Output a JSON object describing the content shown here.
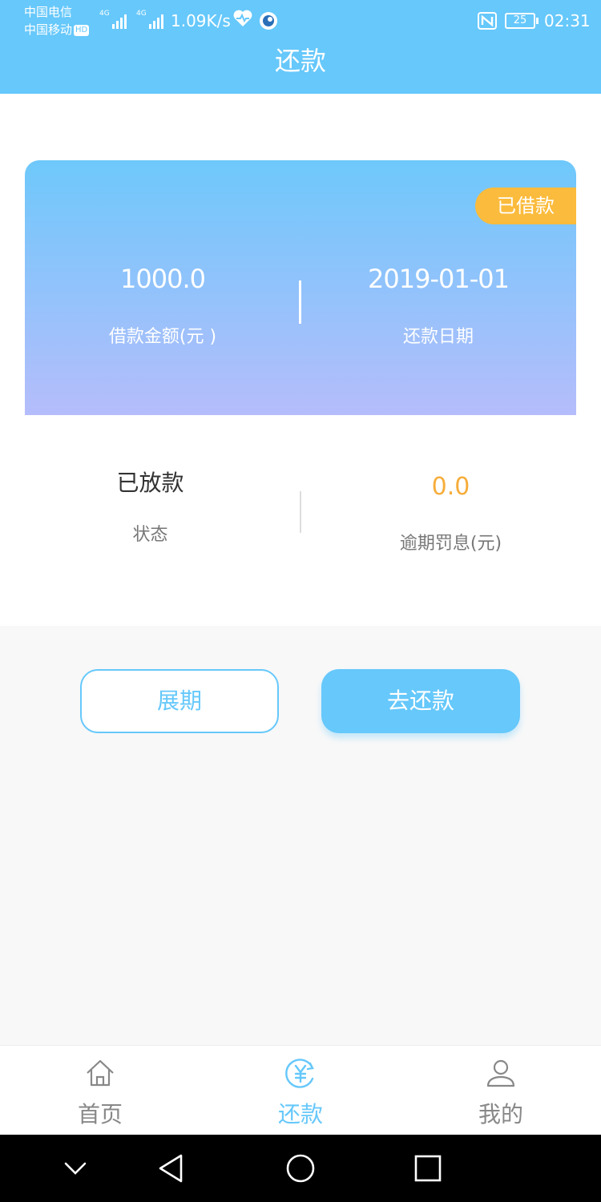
{
  "status_bar": {
    "carrier_1": "中国电信",
    "carrier_2": "中国移动",
    "hd_badge": "HD",
    "network_1": "4G",
    "network_2": "4G",
    "net_speed": "1.09K/s",
    "battery": "25",
    "time": "02:31"
  },
  "header": {
    "title": "还款"
  },
  "loan_card": {
    "badge": "已借款",
    "amount_value": "1000.0",
    "amount_label": "借款金额(元 )",
    "due_date_value": "2019-01-01",
    "due_date_label": "还款日期"
  },
  "info": {
    "status_value": "已放款",
    "status_label": "状态",
    "penalty_value": "0.0",
    "penalty_label": "逾期罚息(元)"
  },
  "actions": {
    "extend_label": "展期",
    "repay_label": "去还款"
  },
  "tabbar": {
    "items": [
      {
        "label": "首页",
        "icon": "home-icon",
        "active": false
      },
      {
        "label": "还款",
        "icon": "yuan-icon",
        "active": true
      },
      {
        "label": "我的",
        "icon": "user-icon",
        "active": false
      }
    ]
  },
  "colors": {
    "primary": "#66c8fb",
    "badge": "#fbbb3c",
    "penalty": "#f6ad3a",
    "card_gradient_top": "#6ec8fb",
    "card_gradient_bottom": "#b5bdfb"
  }
}
